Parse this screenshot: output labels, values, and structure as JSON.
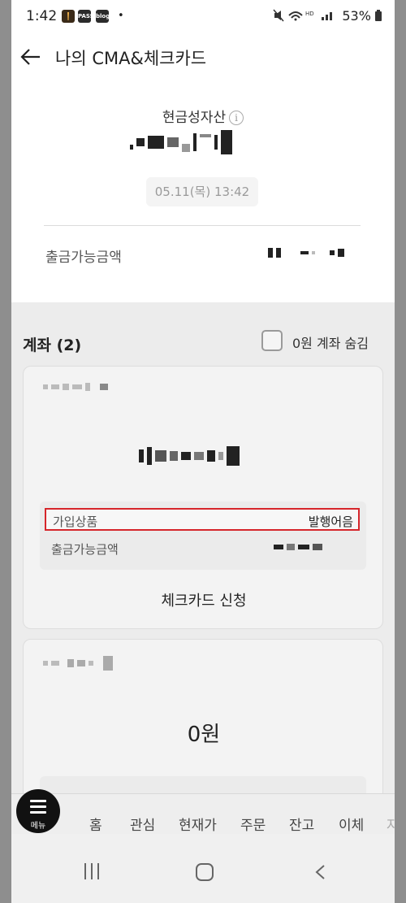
{
  "status_bar": {
    "time": "1:42",
    "app_icons": [
      "PASS",
      "blog"
    ],
    "right_text": "53%"
  },
  "header": {
    "title": "나의 CMA&체크카드"
  },
  "asset": {
    "label": "현금성자산",
    "info_glyph": "i",
    "date": "05.11(목) 13:42",
    "withdraw_label": "출금가능금액"
  },
  "accounts": {
    "title": "계좌 (2)",
    "hide_zero_label": "0원 계좌 숨김",
    "card1": {
      "product_label": "가입상품",
      "product_value": "발행어음",
      "withdraw_label": "출금가능금액",
      "apply_label": "체크카드 신청"
    },
    "card2": {
      "amount": "0원"
    }
  },
  "bottom_nav": {
    "menu_label": "메뉴",
    "items": [
      "홈",
      "관심",
      "현재가",
      "주문",
      "잔고",
      "이체",
      "자"
    ]
  },
  "colors": {
    "highlight_border": "#d6262b",
    "menu_button": "#111111"
  }
}
